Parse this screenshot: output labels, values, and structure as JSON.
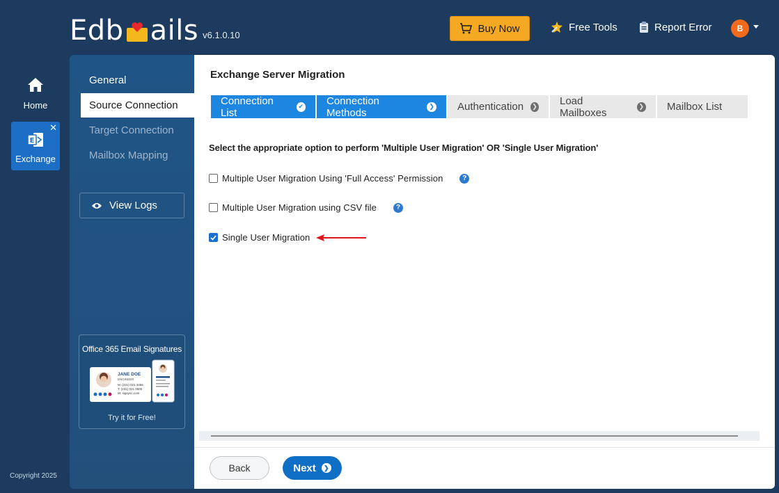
{
  "header": {
    "logo_prefix": "Edb",
    "logo_suffix": "ails",
    "version": "v6.1.0.10",
    "buy_now": "Buy Now",
    "free_tools": "Free Tools",
    "report_error": "Report Error",
    "avatar_initial": "B"
  },
  "rail": {
    "home": "Home",
    "exchange": "Exchange",
    "close": "✕"
  },
  "sidebar": {
    "items": [
      {
        "label": "General"
      },
      {
        "label": "Source Connection"
      },
      {
        "label": "Target Connection"
      },
      {
        "label": "Mailbox Mapping"
      }
    ],
    "view_logs": "View Logs",
    "promo_title": "Office 365 Email Signatures",
    "promo_card_name": "JANE DOE",
    "promo_card_role": "ENGINEER",
    "promo_card_m": "M: (231) 021 3456",
    "promo_card_t": "T: (231) 021 0000",
    "promo_card_w": "W: sigsync.com",
    "promo_cta": "Try it for Free!",
    "copyright": "Copyright 2025"
  },
  "main": {
    "title": "Exchange Server Migration",
    "steps": [
      {
        "label": "Connection List",
        "state": "done"
      },
      {
        "label": "Connection Methods",
        "state": "current"
      },
      {
        "label": "Authentication",
        "state": "pending"
      },
      {
        "label": "Load Mailboxes",
        "state": "pending"
      },
      {
        "label": "Mailbox List",
        "state": "pending"
      }
    ],
    "instruction": "Select the appropriate option to perform 'Multiple User Migration' OR 'Single User Migration'",
    "options": [
      {
        "label": "Multiple User Migration Using 'Full Access' Permission",
        "checked": false
      },
      {
        "label": "Multiple User Migration using CSV file",
        "checked": false
      },
      {
        "label": "Single User Migration",
        "checked": true
      }
    ],
    "back": "Back",
    "next": "Next"
  },
  "colors": {
    "background": "#1c3b5e",
    "accent_blue": "#1c86e0",
    "buy_orange": "#f5a922",
    "arrow_red": "#e0161b"
  }
}
